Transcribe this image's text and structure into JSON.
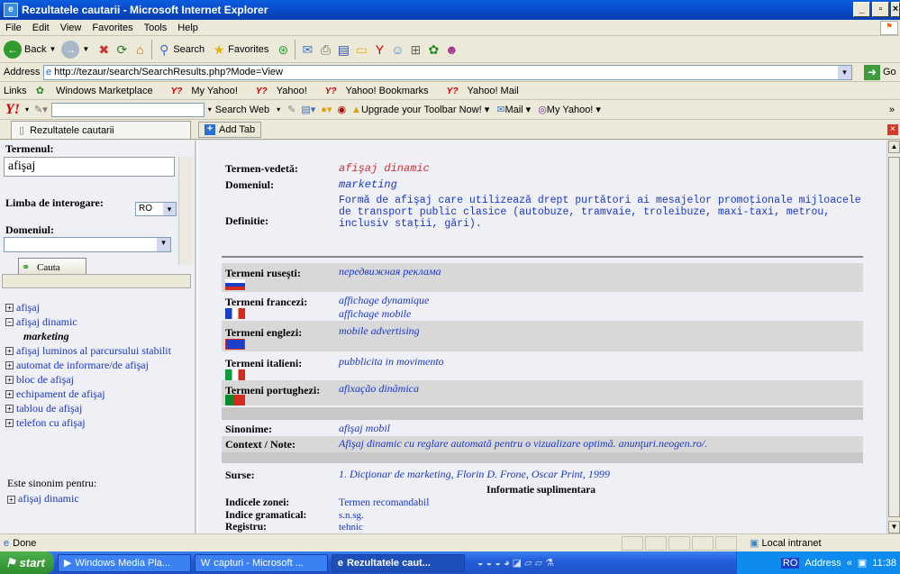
{
  "window": {
    "title": "Rezultatele cautarii - Microsoft Internet Explorer"
  },
  "menu": [
    "File",
    "Edit",
    "View",
    "Favorites",
    "Tools",
    "Help"
  ],
  "toolbar": {
    "back": "Back",
    "search": "Search",
    "favorites": "Favorites"
  },
  "address": {
    "label": "Address",
    "url": "http://tezaur/search/SearchResults.php?Mode=View",
    "go": "Go"
  },
  "links": {
    "label": "Links",
    "items": [
      "Windows Marketplace",
      "My Yahoo!",
      "Yahoo!",
      "Yahoo! Bookmarks",
      "Yahoo! Mail"
    ]
  },
  "yahoo_toolbar": {
    "search_web": "Search Web",
    "upgrade": "Upgrade your Toolbar Now!",
    "mail": "Mail",
    "my_yahoo": "My Yahoo!"
  },
  "tabs": {
    "active": "Rezultatele cautarii",
    "add": "Add Tab"
  },
  "left": {
    "termen_label": "Termenul:",
    "termen_value": "afişaj",
    "limba_label": "Limba de interogare:",
    "limba_value": "RO",
    "domeniu_label": "Domeniul:",
    "cauta": "Cauta",
    "tree": [
      {
        "label": "afişaj",
        "box": "+"
      },
      {
        "label": "afişaj dinamic",
        "box": "−"
      },
      {
        "label": "afişaj luminos al parcursului stabilit",
        "box": "+"
      },
      {
        "label": "automat de informare/de afişaj",
        "box": "+"
      },
      {
        "label": "bloc de afişaj",
        "box": "+"
      },
      {
        "label": "echipament de afişaj",
        "box": "+"
      },
      {
        "label": "tablou de afişaj",
        "box": "+"
      },
      {
        "label": "telefon cu afişaj",
        "box": "+"
      }
    ],
    "sub_item": "marketing",
    "sinonim_label": "Este sinonim pentru:",
    "sinonim_item": "afişaj dinamic"
  },
  "main": {
    "termen_vedeta_label": "Termen-vedetă:",
    "termen_vedeta_value": "afişaj dinamic",
    "domeniul_label": "Domeniul:",
    "domeniul_value": "marketing",
    "definitie_label": "Definitie:",
    "definitie_value": "Formă de afişaj care utilizează drept purtători ai mesajelor promoţionale mijloacele de transport public clasice (autobuze, tramvaie, troleibuze, maxi-taxi, metrou, inclusiv staţii, gări).",
    "rusesti_label": "Termeni ruseşti:",
    "rusesti_value": "передвижная реклама",
    "francezi_label": "Termeni francezi:",
    "francezi_values": [
      "affichage dynamique",
      "affichage mobile"
    ],
    "englezi_label": "Termeni englezi:",
    "englezi_value": "mobile advertising",
    "italieni_label": "Termeni italieni:",
    "italieni_value": "pubblicita in movimento",
    "portughezi_label": "Termeni portughezi:",
    "portughezi_value": "afixação dinâmica",
    "sinonime_label": "Sinonime:",
    "sinonime_value": "afişaj mobil",
    "context_label": "Context / Note:",
    "context_value": "Afişaj dinamic cu reglare automată pentru o vizualizare optimă. anunţuri.neogen.ro/.",
    "surse_label": "Surse:",
    "surse_value": "1. Dicţionar de marketing, Florin D. Frone, Oscar Print, 1999",
    "info_heading": "Informatie suplimentara",
    "indice_zonei_label": "Indicele zonei:",
    "indice_zonei_value": "Termen recomandabil",
    "indice_gramatical_label": "Indice gramatical:",
    "indice_gramatical_value": "s.n.sg.",
    "registru_label": "Registru:",
    "registru_value": "tehnic"
  },
  "status": {
    "text": "Done",
    "zone": "Local intranet"
  },
  "taskbar": {
    "start": "start",
    "items": [
      "Windows Media Pla...",
      "capturi - Microsoft ...",
      "Rezultatele caut..."
    ],
    "lang": "RO",
    "address": "Address",
    "clock": "11:38"
  }
}
